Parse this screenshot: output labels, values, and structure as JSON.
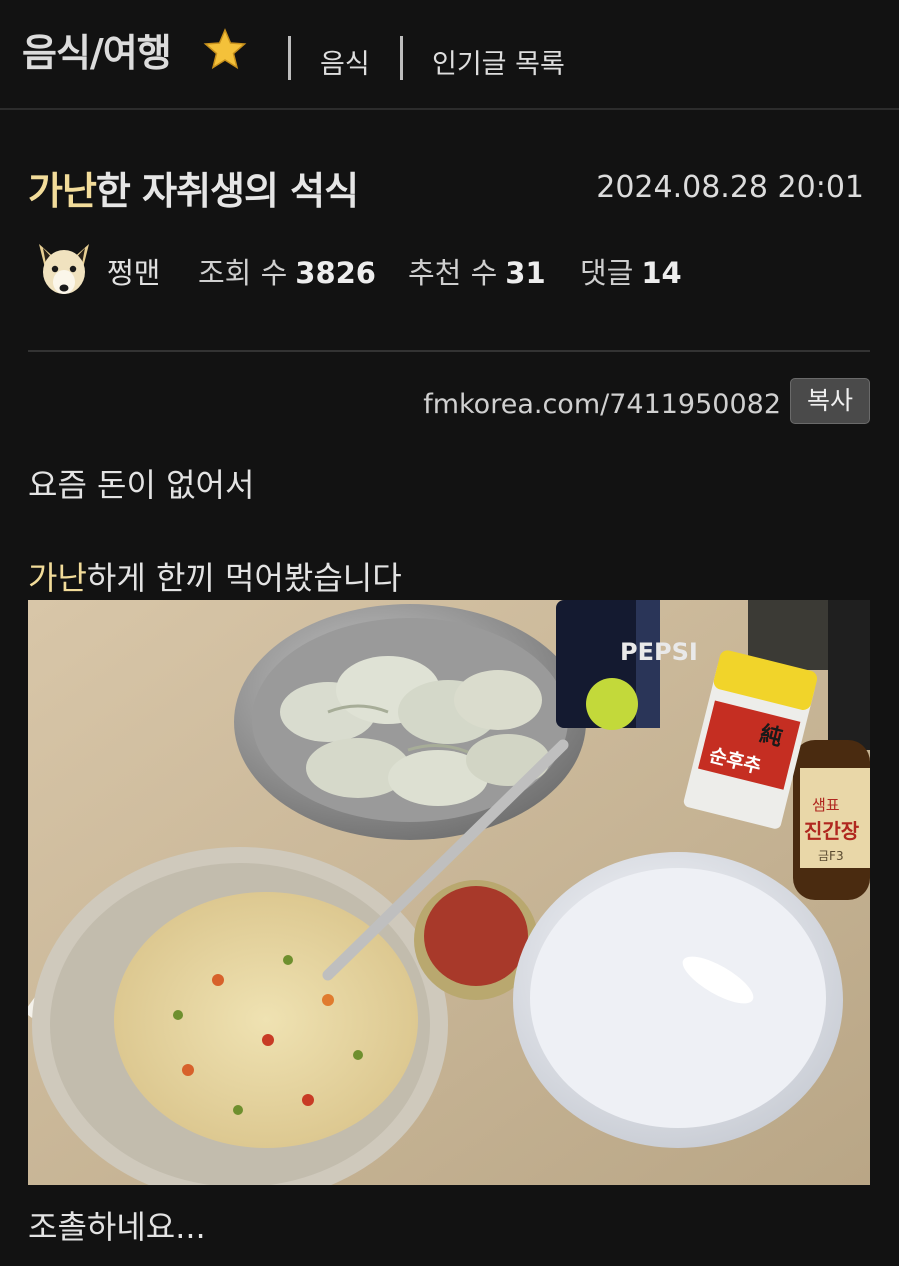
{
  "header": {
    "board_title": "음식/여행",
    "nav": [
      "음식",
      "인기글 목록"
    ]
  },
  "post": {
    "title_highlight": "가난",
    "title_rest": "한 자취생의 석식",
    "date": "2024.08.28 20:01",
    "author": "쩡맨",
    "stats": {
      "views_label": "조회 수",
      "views": "3826",
      "recommends_label": "추천 수",
      "recommends": "31",
      "comments_label": "댓글",
      "comments": "14"
    },
    "url": "fmkorea.com/7411950082",
    "copy_label": "복사",
    "body": {
      "line1": "요즘 돈이 없어서",
      "line2_highlight": "가난",
      "line2_rest": "하게 한끼 먹어봤습니다",
      "caption": "조촐하네요..."
    },
    "photo": {
      "can_brand": "PEPSI",
      "pepper_brand": "純",
      "pepper_name": "순후추",
      "soy_brand": "샘표",
      "soy_name": "진간장",
      "soy_sub": "금F3"
    }
  },
  "colors": {
    "background": "#121212",
    "highlight": "#f2dc9a"
  }
}
